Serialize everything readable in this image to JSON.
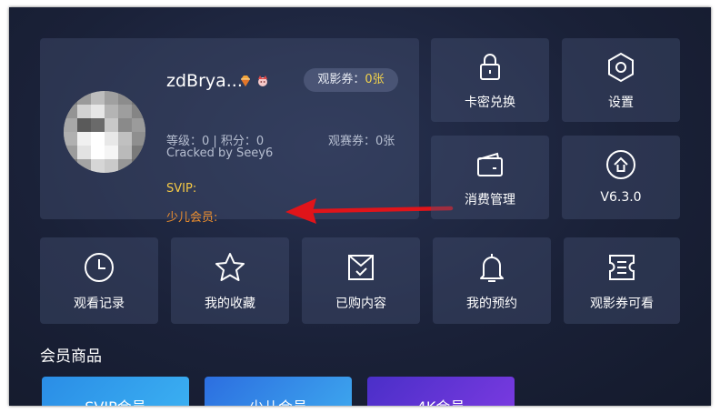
{
  "profile": {
    "username": "zdBrya...",
    "ticket_label": "观影券：",
    "ticket_count": "0张",
    "level_points": "等级：0 | 积分：0",
    "cracked_by": "Cracked by Seey6",
    "match_tickets": "观赛券：0张",
    "svip_label": "SVIP:",
    "kid_member_label": "少儿会员:"
  },
  "top_tiles": [
    {
      "label": "卡密兑换",
      "icon": "lock-icon"
    },
    {
      "label": "设置",
      "icon": "hexagon-gear-icon"
    },
    {
      "label": "消费管理",
      "icon": "wallet-icon"
    },
    {
      "label": "V6.3.0",
      "icon": "upload-arrow-icon"
    }
  ],
  "bottom_tiles": [
    {
      "label": "观看记录",
      "icon": "clock-icon"
    },
    {
      "label": "我的收藏",
      "icon": "star-icon"
    },
    {
      "label": "已购内容",
      "icon": "purchased-bag-icon"
    },
    {
      "label": "我的预约",
      "icon": "bell-icon"
    },
    {
      "label": "观影券可看",
      "icon": "ticket-icon"
    }
  ],
  "section": {
    "title": "会员商品"
  },
  "cards": [
    {
      "label": "SVIP会员"
    },
    {
      "label": "少儿会员"
    },
    {
      "label": "4K会员"
    }
  ],
  "colors": {
    "gold": "#f5c945",
    "orange": "#f0902e",
    "arrow_red": "#e0141a"
  }
}
